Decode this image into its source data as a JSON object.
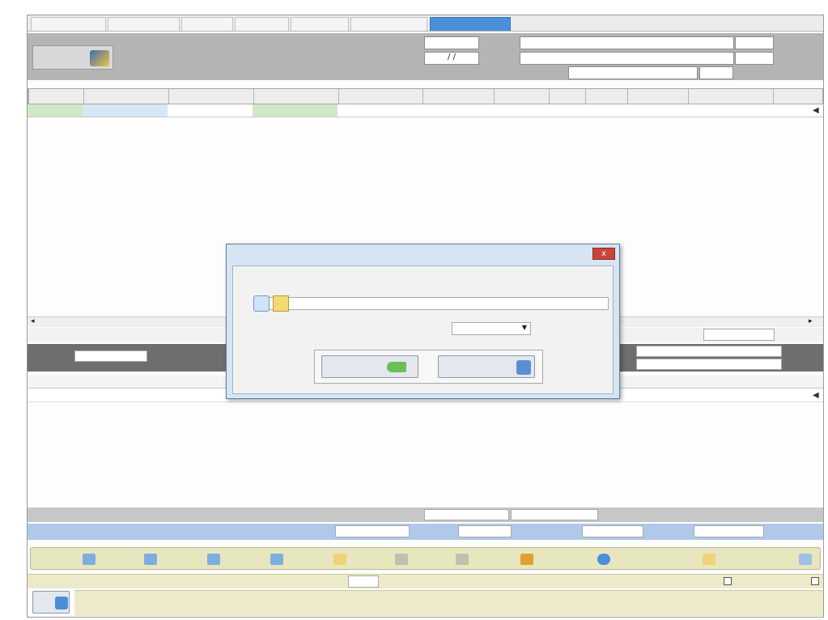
{
  "window": {
    "title": ""
  },
  "tabs": [
    {
      "label": ""
    },
    {
      "label": ""
    },
    {
      "label": ""
    },
    {
      "label": ""
    },
    {
      "label": ""
    },
    {
      "label": ""
    },
    {
      "label": ""
    }
  ],
  "header": {
    "customer_label": "",
    "detail2_label": "",
    "account_type_label": "",
    "number_label": "",
    "date_label": "",
    "date_value": "/ /",
    "extra_info_button": ""
  },
  "grid": {
    "columns": [
      "",
      "",
      "",
      "",
      "",
      "",
      "",
      "",
      "",
      "",
      "",
      "",
      ""
    ]
  },
  "summary": {
    "sales_amount_label": "",
    "discounts_label": "",
    "warehouse_name_label": "",
    "product_name_label": "",
    "total_subunits_label": ""
  },
  "lower_grid": {
    "col_discounts": "",
    "col_title": ""
  },
  "totals": {
    "sum_label": "",
    "invoice_total_label": "",
    "prepayment_label": "",
    "other_accounts_label": "",
    "payable_label": ""
  },
  "toolbar": {
    "accounts": "",
    "customer_card": "",
    "help": "",
    "tools": "",
    "cancel": "",
    "delete": "",
    "create": "",
    "last": "",
    "next": "",
    "prev": "",
    "first": ""
  },
  "status": {
    "post_label": "",
    "issue_voucher_label": "",
    "voucher_number_label": "",
    "last_exit_order_label": "",
    "user_label": "",
    "update_date_label": "",
    "update_time_label": "",
    "fiscal_period": "",
    "exit_button": ""
  },
  "dialog": {
    "title": "",
    "close_glyph": "x",
    "excel_path_label": "",
    "excel_path_value": "",
    "sheet_label": "",
    "sheet_value": "",
    "show_button": "",
    "cancel_button": ""
  },
  "colors": {
    "tab_active": "#4a90d9",
    "header_band": "#b4b4b4",
    "grid_green": "#cfe9c8",
    "blue_band": "#b0c8e9",
    "toolbar": "#e8e6bf",
    "dialog_bg": "#d7e4f2",
    "close_red": "#c9453c"
  }
}
